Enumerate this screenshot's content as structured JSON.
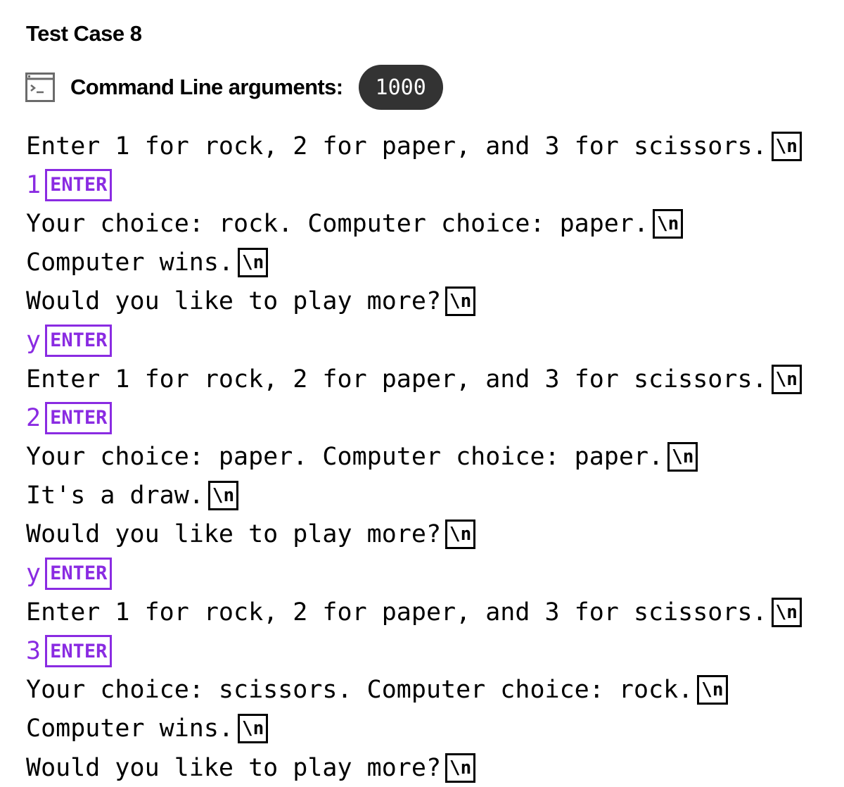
{
  "title": "Test Case 8",
  "command_line": {
    "icon": "terminal-icon",
    "label": "Command Line arguments:",
    "value": "1000"
  },
  "colors": {
    "input": "#8a2be2",
    "pill_bg": "#333333",
    "text": "#000000"
  },
  "markers": {
    "newline": "\\n",
    "enter": "ENTER"
  },
  "console": [
    {
      "type": "output",
      "text": "Enter 1 for rock, 2 for paper, and 3 for scissors."
    },
    {
      "type": "input",
      "text": "1"
    },
    {
      "type": "output",
      "text": "Your choice: rock. Computer choice: paper."
    },
    {
      "type": "output",
      "text": "Computer wins."
    },
    {
      "type": "output",
      "text": "Would you like to play more?"
    },
    {
      "type": "input",
      "text": "y"
    },
    {
      "type": "output",
      "text": "Enter 1 for rock, 2 for paper, and 3 for scissors."
    },
    {
      "type": "input",
      "text": "2"
    },
    {
      "type": "output",
      "text": "Your choice: paper. Computer choice: paper."
    },
    {
      "type": "output",
      "text": "It's a draw."
    },
    {
      "type": "output",
      "text": "Would you like to play more?"
    },
    {
      "type": "input",
      "text": "y"
    },
    {
      "type": "output",
      "text": "Enter 1 for rock, 2 for paper, and 3 for scissors."
    },
    {
      "type": "input",
      "text": "3"
    },
    {
      "type": "output",
      "text": "Your choice: scissors. Computer choice: rock."
    },
    {
      "type": "output",
      "text": "Computer wins."
    },
    {
      "type": "output",
      "text": "Would you like to play more?"
    }
  ]
}
